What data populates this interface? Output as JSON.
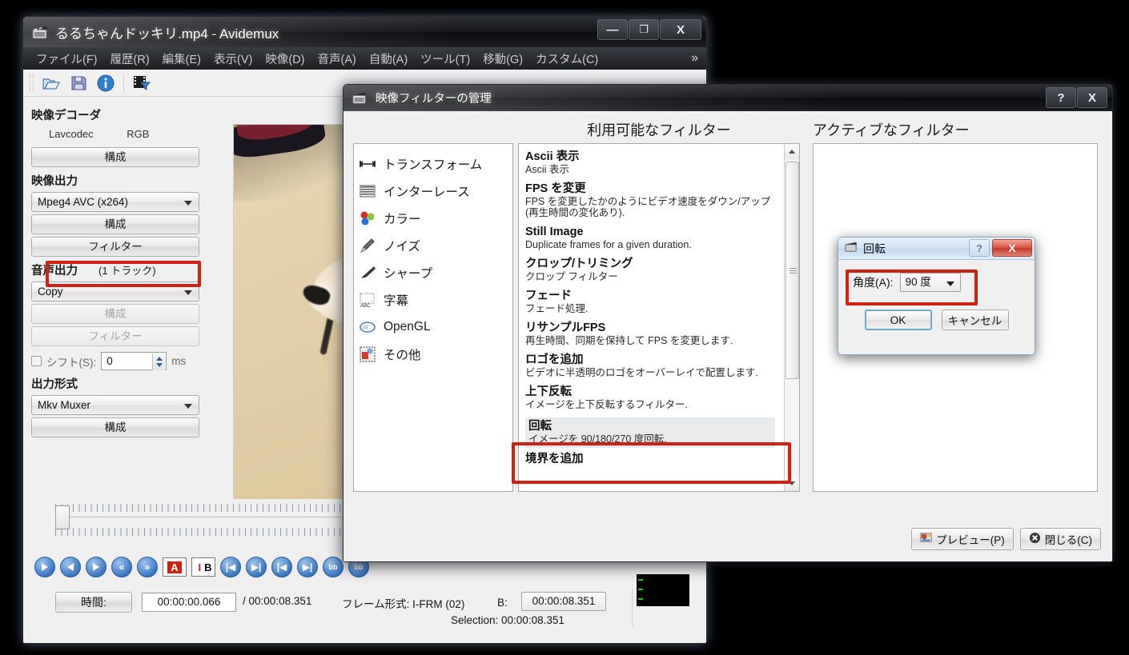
{
  "main_window": {
    "title": "るるちゃんドッキリ.mp4 - Avidemux",
    "title_icon": "film-clapper-icon",
    "window_buttons": {
      "minimize": "—",
      "maximize": "❐",
      "close": "X"
    },
    "menu": [
      "ファイル(F)",
      "履歴(R)",
      "編集(E)",
      "表示(V)",
      "映像(D)",
      "音声(A)",
      "自動(A)",
      "ツール(T)",
      "移動(G)",
      "カスタム(C)"
    ],
    "menu_overflow": "»",
    "toolbar_icons": [
      "open-folder-icon",
      "save-disk-icon",
      "info-icon",
      "video-filter-icon"
    ]
  },
  "left_panel": {
    "video_decoder": {
      "heading": "映像デコーダ",
      "codec": "Lavcodec",
      "colorspace": "RGB",
      "configure_label": "構成"
    },
    "video_output": {
      "heading": "映像出力",
      "codec_value": "Mpeg4 AVC (x264)",
      "configure_label": "構成",
      "filter_label": "フィルター"
    },
    "audio_output": {
      "heading": "音声出力",
      "tracks": "(1 トラック)",
      "codec_value": "Copy",
      "configure_label": "構成",
      "filter_label": "フィルター",
      "shift_label": "シフト(S):",
      "shift_value": "0",
      "shift_unit": "ms"
    },
    "output_format": {
      "heading": "出力形式",
      "muxer_value": "Mkv Muxer",
      "configure_label": "構成"
    }
  },
  "status_bar": {
    "time_button": "時間:",
    "current_time": "00:00:00.066",
    "separator": "/",
    "total_time": "00:00:08.351",
    "frame_type": "フレーム形式: I-FRM (02)",
    "b_label": "B:",
    "b_value": "00:00:08.351",
    "selection": "Selection: 00:00:08.351"
  },
  "transport_buttons": [
    "play-button",
    "previous-frame-button",
    "next-frame-button",
    "rewind-button",
    "fast-forward-button",
    "marker-a-button",
    "marker-b-button",
    "prev-keyframe-button",
    "next-keyframe-button",
    "go-start-button",
    "go-end-button",
    "prev-black-frame-button",
    "next-black-frame-button"
  ],
  "filter_dialog": {
    "title": "映像フィルターの管理",
    "title_icon": "film-clapper-icon",
    "help_button": "?",
    "close_button": "X",
    "available_heading": "利用可能なフィルター",
    "active_heading": "アクティブなフィルター",
    "categories": [
      {
        "label": "トランスフォーム",
        "icon": "transform-icon"
      },
      {
        "label": "インターレース",
        "icon": "interlace-icon"
      },
      {
        "label": "カラー",
        "icon": "color-icon"
      },
      {
        "label": "ノイズ",
        "icon": "noise-icon"
      },
      {
        "label": "シャープ",
        "icon": "sharpen-icon"
      },
      {
        "label": "字幕",
        "icon": "subtitle-icon"
      },
      {
        "label": "OpenGL",
        "icon": "opengl-icon"
      },
      {
        "label": "その他",
        "icon": "misc-icon"
      }
    ],
    "filters": [
      {
        "name": "Ascii 表示",
        "desc": "Ascii 表示",
        "selected": false
      },
      {
        "name": "FPS を変更",
        "desc": "FPS を変更したかのようにビデオ速度をダウン/アップ (再生時間の変化あり).",
        "selected": false
      },
      {
        "name": "Still Image",
        "desc": "Duplicate frames for a given duration.",
        "selected": false
      },
      {
        "name": "クロップ/トリミング",
        "desc": "クロップ フィルター",
        "selected": false
      },
      {
        "name": "フェード",
        "desc": "フェード処理.",
        "selected": false
      },
      {
        "name": "リサンプルFPS",
        "desc": "再生時間、同期を保持して FPS を変更します.",
        "selected": false
      },
      {
        "name": "ロゴを追加",
        "desc": "ビデオに半透明のロゴをオーバーレイで配置します.",
        "selected": false
      },
      {
        "name": "上下反転",
        "desc": "イメージを上下反転するフィルター.",
        "selected": false
      },
      {
        "name": "回転",
        "desc": "イメージを 90/180/270 度回転.",
        "selected": true
      },
      {
        "name": "境界を追加",
        "desc": "",
        "selected": false
      }
    ],
    "active_filters": [],
    "preview_button": "プレビュー(P)",
    "close_dialog_button": "閉じる(C)"
  },
  "rotate_dialog": {
    "title": "回転",
    "title_icon": "film-clapper-icon",
    "help_button": "?",
    "close_button": "X",
    "angle_label": "角度(A):",
    "angle_value": "90 度",
    "ok_button": "OK",
    "cancel_button": "キャンセル"
  },
  "highlights": {
    "color": "#cf2212",
    "regions": [
      "filter-button",
      "rotate-filter-item",
      "angle-selector"
    ]
  }
}
